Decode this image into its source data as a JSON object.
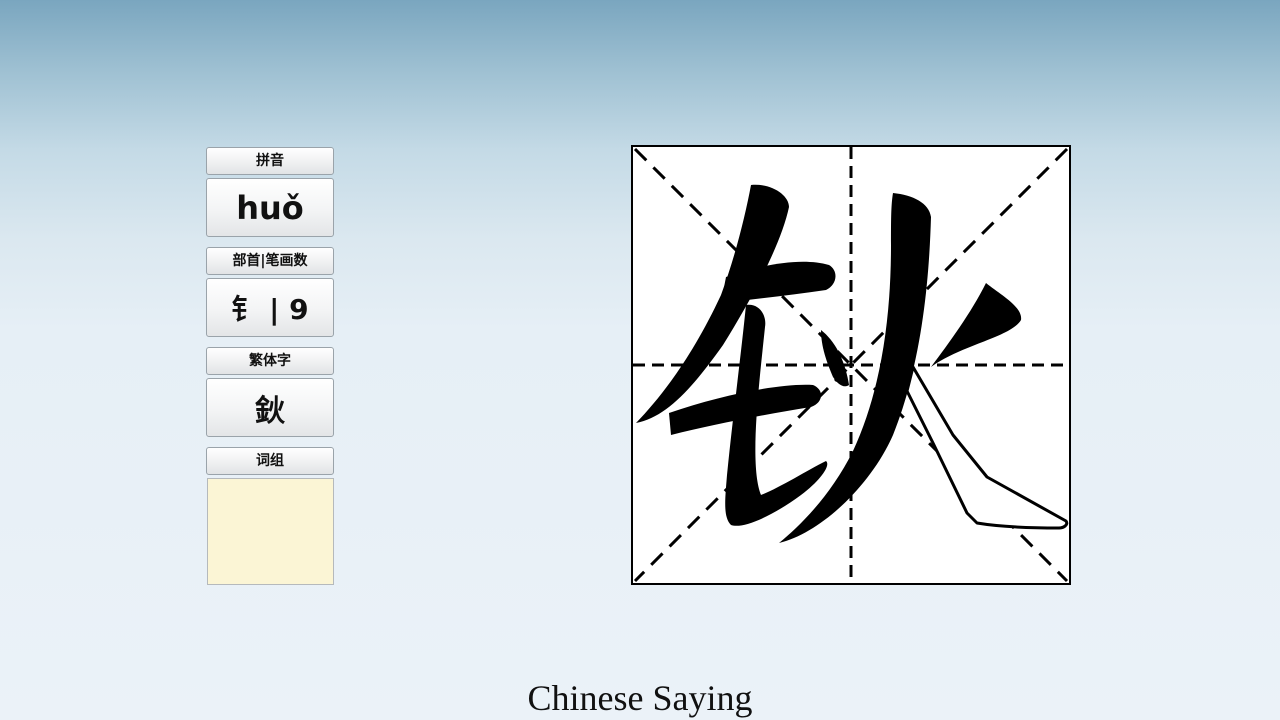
{
  "panel": {
    "pinyin_label": "拼音",
    "pinyin_value": "huǒ",
    "radical_label": "部首|笔画数",
    "radical_value": "钅 | 9",
    "traditional_label": "繁体字",
    "traditional_value": "鈥",
    "words_label": "词组",
    "words_value": ""
  },
  "character": {
    "glyph": "钬",
    "grid_style": "米字格"
  },
  "caption": "Chinese Saying"
}
